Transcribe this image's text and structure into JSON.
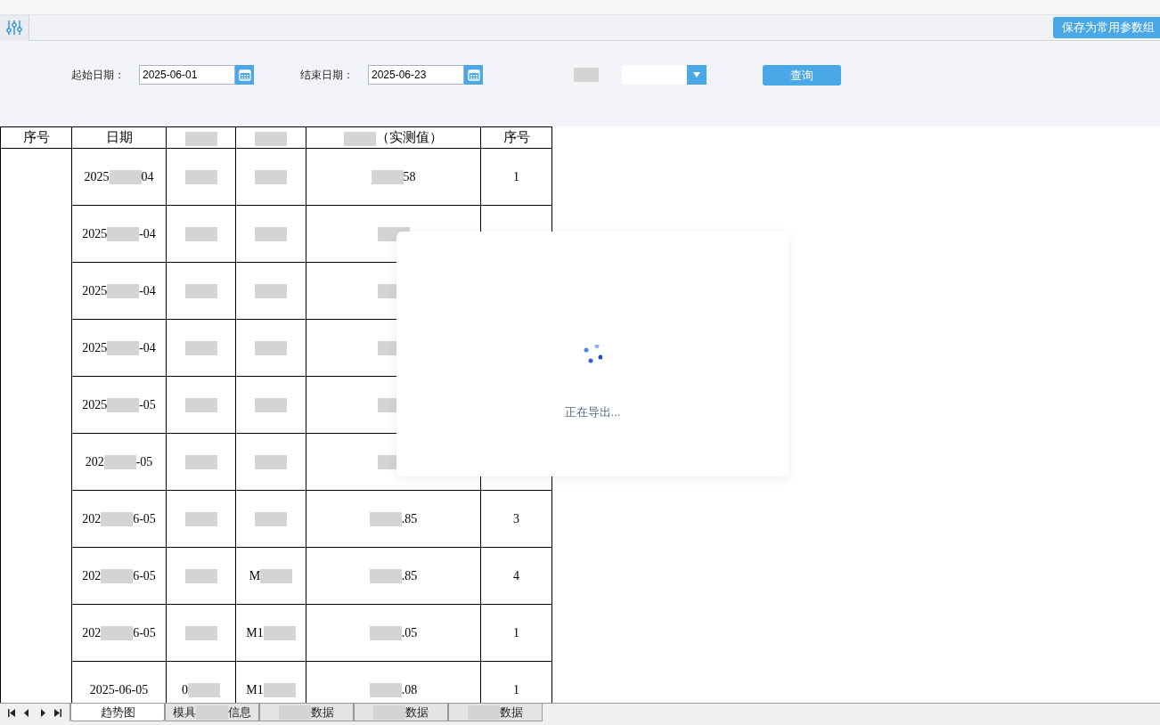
{
  "toolbar": {
    "save_button": "保存为常用参数组"
  },
  "filters": [
    {
      "kind": "date",
      "label": "起始日期：",
      "value": "2025-06-01"
    },
    {
      "kind": "date",
      "label": "结束日期：",
      "value": "2025-06-23"
    },
    {
      "kind": "select"
    }
  ],
  "query_button": "查询",
  "table": {
    "columns": [
      {
        "label": "序号"
      },
      {
        "label": "日期"
      },
      {
        "redacted": true
      },
      {
        "redacted": true
      },
      {
        "label": "（实测值）",
        "redacted": true
      },
      {
        "label": "序号"
      }
    ],
    "rows": [
      {
        "cells": [
          {
            "rowspan": 10
          },
          {
            "parts": [
              {
                "kind": "text",
                "text": "2025"
              },
              {
                "kind": "redacted"
              },
              {
                "kind": "text",
                "text": "04"
              }
            ]
          },
          {
            "parts": [
              {
                "kind": "redacted"
              }
            ]
          },
          {
            "parts": [
              {
                "kind": "redacted"
              }
            ]
          },
          {
            "parts": [
              {
                "kind": "redacted"
              },
              {
                "kind": "text",
                "text": "58"
              }
            ]
          },
          {
            "parts": [
              {
                "kind": "text",
                "text": "1"
              }
            ]
          }
        ]
      },
      {
        "cells": [
          {
            "parts": [
              {
                "kind": "text",
                "text": "2025"
              },
              {
                "kind": "redacted"
              },
              {
                "kind": "text",
                "text": "-04"
              }
            ]
          },
          {
            "parts": [
              {
                "kind": "redacted"
              }
            ]
          },
          {
            "parts": [
              {
                "kind": "redacted"
              }
            ]
          },
          {
            "parts": [
              {
                "kind": "redacted"
              }
            ]
          },
          {}
        ]
      },
      {
        "cells": [
          {
            "parts": [
              {
                "kind": "text",
                "text": "2025"
              },
              {
                "kind": "redacted"
              },
              {
                "kind": "text",
                "text": "-04"
              }
            ]
          },
          {
            "parts": [
              {
                "kind": "redacted"
              }
            ]
          },
          {
            "parts": [
              {
                "kind": "redacted"
              }
            ]
          },
          {
            "parts": [
              {
                "kind": "redacted"
              }
            ]
          },
          {}
        ]
      },
      {
        "cells": [
          {
            "parts": [
              {
                "kind": "text",
                "text": "2025"
              },
              {
                "kind": "redacted"
              },
              {
                "kind": "text",
                "text": "-04"
              }
            ]
          },
          {
            "parts": [
              {
                "kind": "redacted"
              }
            ]
          },
          {
            "parts": [
              {
                "kind": "redacted"
              }
            ]
          },
          {
            "parts": [
              {
                "kind": "redacted"
              }
            ]
          },
          {}
        ]
      },
      {
        "cells": [
          {
            "parts": [
              {
                "kind": "text",
                "text": "2025"
              },
              {
                "kind": "redacted"
              },
              {
                "kind": "text",
                "text": "-05"
              }
            ]
          },
          {
            "parts": [
              {
                "kind": "redacted"
              }
            ]
          },
          {
            "parts": [
              {
                "kind": "redacted"
              }
            ]
          },
          {
            "parts": [
              {
                "kind": "redacted"
              }
            ]
          },
          {}
        ]
      },
      {
        "cells": [
          {
            "parts": [
              {
                "kind": "text",
                "text": "202"
              },
              {
                "kind": "redacted"
              },
              {
                "kind": "text",
                "text": "-05"
              }
            ]
          },
          {
            "parts": [
              {
                "kind": "redacted"
              }
            ]
          },
          {
            "parts": [
              {
                "kind": "redacted"
              }
            ]
          },
          {
            "parts": [
              {
                "kind": "redacted"
              }
            ]
          },
          {}
        ]
      },
      {
        "cells": [
          {
            "parts": [
              {
                "kind": "text",
                "text": "202"
              },
              {
                "kind": "redacted"
              },
              {
                "kind": "text",
                "text": "6-05"
              }
            ]
          },
          {
            "parts": [
              {
                "kind": "redacted"
              }
            ]
          },
          {
            "parts": [
              {
                "kind": "redacted"
              }
            ]
          },
          {
            "parts": [
              {
                "kind": "redacted"
              },
              {
                "kind": "text",
                "text": ".85"
              }
            ]
          },
          {
            "parts": [
              {
                "kind": "text",
                "text": "3"
              }
            ]
          }
        ]
      },
      {
        "cells": [
          {
            "parts": [
              {
                "kind": "text",
                "text": "202"
              },
              {
                "kind": "redacted"
              },
              {
                "kind": "text",
                "text": "6-05"
              }
            ]
          },
          {
            "parts": [
              {
                "kind": "redacted"
              }
            ]
          },
          {
            "parts": [
              {
                "kind": "text",
                "text": "M"
              },
              {
                "kind": "redacted"
              }
            ]
          },
          {
            "parts": [
              {
                "kind": "redacted"
              },
              {
                "kind": "text",
                "text": ".85"
              }
            ]
          },
          {
            "parts": [
              {
                "kind": "text",
                "text": "4"
              }
            ]
          }
        ]
      },
      {
        "cells": [
          {
            "parts": [
              {
                "kind": "text",
                "text": "202"
              },
              {
                "kind": "redacted"
              },
              {
                "kind": "text",
                "text": "6-05"
              }
            ]
          },
          {
            "parts": [
              {
                "kind": "redacted"
              }
            ]
          },
          {
            "parts": [
              {
                "kind": "text",
                "text": "M1"
              },
              {
                "kind": "redacted"
              }
            ]
          },
          {
            "parts": [
              {
                "kind": "redacted"
              },
              {
                "kind": "text",
                "text": ".05"
              }
            ]
          },
          {
            "parts": [
              {
                "kind": "text",
                "text": "1"
              }
            ]
          }
        ]
      },
      {
        "cells": [
          {
            "parts": [
              {
                "kind": "text",
                "text": "2025-06-05"
              }
            ]
          },
          {
            "parts": [
              {
                "kind": "text",
                "text": "0"
              },
              {
                "kind": "redacted"
              }
            ]
          },
          {
            "parts": [
              {
                "kind": "text",
                "text": "M1"
              },
              {
                "kind": "redacted"
              }
            ]
          },
          {
            "parts": [
              {
                "kind": "redacted"
              },
              {
                "kind": "text",
                "text": ".08"
              }
            ]
          },
          {
            "parts": [
              {
                "kind": "text",
                "text": "1"
              }
            ]
          }
        ]
      }
    ]
  },
  "sheet_tabs": [
    {
      "selected": true,
      "parts": [
        {
          "kind": "text",
          "text": "趋势图"
        }
      ]
    },
    {
      "selected": false,
      "parts": [
        {
          "kind": "text",
          "text": "模具"
        },
        {
          "kind": "redacted"
        },
        {
          "kind": "text",
          "text": "信息"
        }
      ]
    },
    {
      "selected": false,
      "parts": [
        {
          "kind": "redacted"
        },
        {
          "kind": "text",
          "text": "数据"
        }
      ]
    },
    {
      "selected": false,
      "parts": [
        {
          "kind": "redacted"
        },
        {
          "kind": "text",
          "text": "数据"
        }
      ]
    },
    {
      "selected": false,
      "parts": [
        {
          "kind": "redacted"
        },
        {
          "kind": "text",
          "text": "数据"
        }
      ]
    }
  ],
  "loading_dialog": {
    "message": "正在导出..."
  }
}
